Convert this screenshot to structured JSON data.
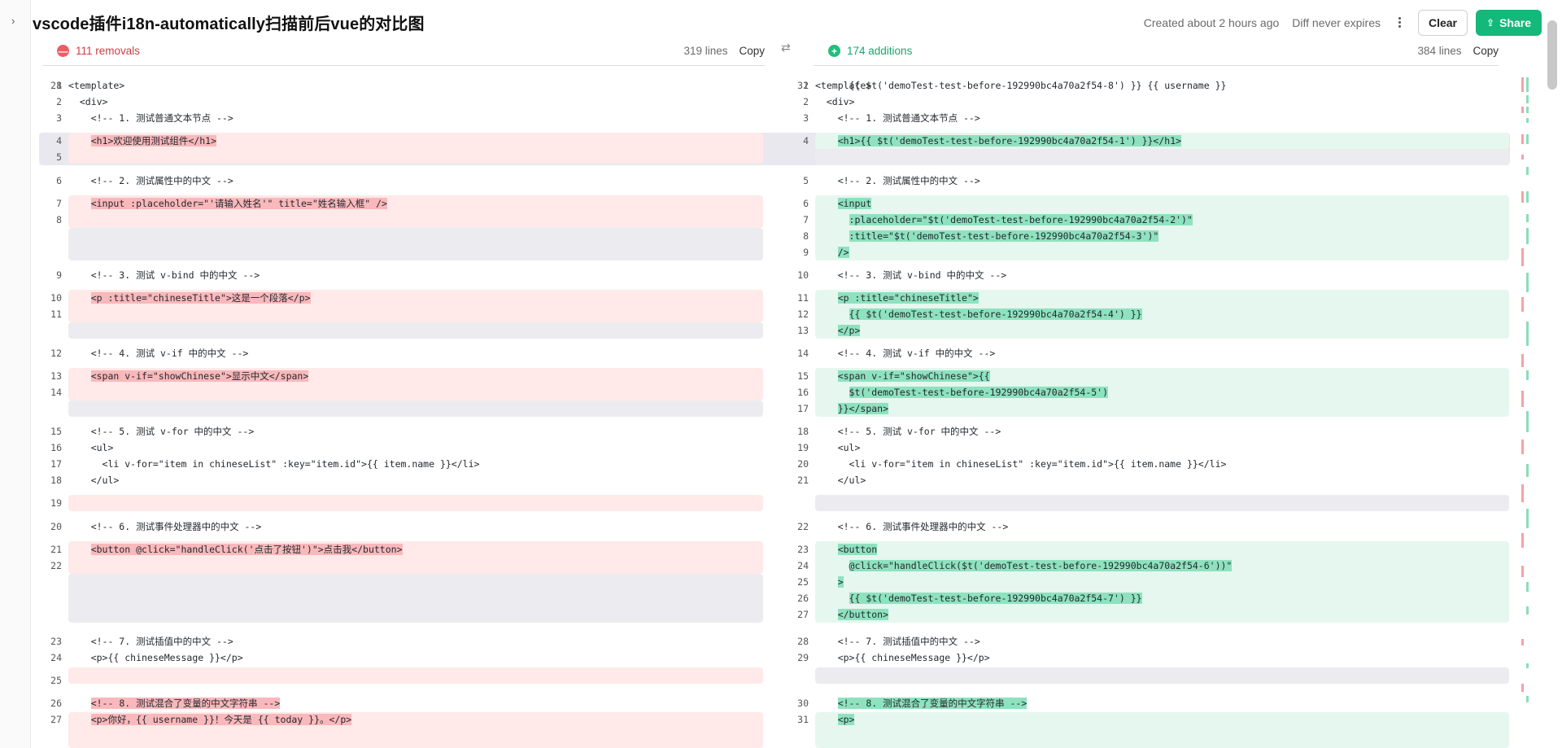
{
  "title": "vscode插件i18n-automatically扫描前后vue的对比图",
  "meta": {
    "created": "Created about 2 hours ago",
    "expires": "Diff never expires"
  },
  "buttons": {
    "clear": "Clear",
    "share": "Share"
  },
  "left": {
    "badge": "—",
    "stat": "111 removals",
    "lines": "319 lines",
    "copy": "Copy"
  },
  "right": {
    "badge": "+",
    "stat": "174 additions",
    "lines": "384 lines",
    "copy": "Copy"
  },
  "colors": {
    "removal": "#ffe9e9",
    "removal_highlight": "#f9b8bb",
    "addition": "#e6f7ef",
    "addition_highlight": "#8ee2bf",
    "share": "#14b87a"
  },
  "icons": {
    "sidebar": "chevron-right-icon",
    "menu": "more-vertical-icon",
    "share": "share-icon",
    "swap": "swap-icon"
  },
  "rows": [
    {
      "l": "1",
      "lt": "<template>",
      "r": "1",
      "rt": "<template>"
    },
    {
      "l": "2",
      "lt": "  <div>",
      "r": "2",
      "rt": "  <div>"
    },
    {
      "l": "3",
      "lt": "    <!-- 1. 测试普通文本节点 -->",
      "r": "3",
      "rt": "    <!-- 1. 测试普通文本节点 -->"
    },
    {
      "l": "4",
      "lt": "    <h1>欢迎使用测试组件</h1>",
      "r": "4",
      "rt": "    <h1>{{ $t('demoTest-test-before-192990bc4a70a2f54-1') }}</h1>"
    },
    {
      "l": "5",
      "lt": "",
      "r": "",
      "rt": ""
    },
    {
      "l": "6",
      "lt": "    <!-- 2. 测试属性中的中文 -->",
      "r": "5",
      "rt": "    <!-- 2. 测试属性中的中文 -->"
    },
    {
      "l": "7",
      "lt": "    <input :placeholder=\"'请输入姓名'\" title=\"姓名输入框\" />",
      "r": "6",
      "rt": "    <input"
    },
    {
      "l": "8",
      "lt": "",
      "r": "7",
      "rt": "      :placeholder=\"$t('demoTest-test-before-192990bc4a70a2f54-2')\""
    },
    {
      "l": "",
      "lt": "",
      "r": "8",
      "rt": "      :title=\"$t('demoTest-test-before-192990bc4a70a2f54-3')\""
    },
    {
      "l": "",
      "lt": "",
      "r": "9",
      "rt": "    />"
    },
    {
      "l": "9",
      "lt": "    <!-- 3. 测试 v-bind 中的中文 -->",
      "r": "10",
      "rt": "    <!-- 3. 测试 v-bind 中的中文 -->"
    },
    {
      "l": "10",
      "lt": "    <p :title=\"chineseTitle\">这是一个段落</p>",
      "r": "11",
      "rt": "    <p :title=\"chineseTitle\">"
    },
    {
      "l": "11",
      "lt": "",
      "r": "12",
      "rt": "      {{ $t('demoTest-test-before-192990bc4a70a2f54-4') }}"
    },
    {
      "l": "",
      "lt": "",
      "r": "13",
      "rt": "    </p>"
    },
    {
      "l": "12",
      "lt": "    <!-- 4. 测试 v-if 中的中文 -->",
      "r": "14",
      "rt": "    <!-- 4. 测试 v-if 中的中文 -->"
    },
    {
      "l": "13",
      "lt": "    <span v-if=\"showChinese\">显示中文</span>",
      "r": "15",
      "rt": "    <span v-if=\"showChinese\">{{"
    },
    {
      "l": "14",
      "lt": "",
      "r": "16",
      "rt": "      $t('demoTest-test-before-192990bc4a70a2f54-5')"
    },
    {
      "l": "",
      "lt": "",
      "r": "17",
      "rt": "    }}</span>"
    },
    {
      "l": "15",
      "lt": "    <!-- 5. 测试 v-for 中的中文 -->",
      "r": "18",
      "rt": "    <!-- 5. 测试 v-for 中的中文 -->"
    },
    {
      "l": "16",
      "lt": "    <ul>",
      "r": "19",
      "rt": "    <ul>"
    },
    {
      "l": "17",
      "lt": "      <li v-for=\"item in chineseList\" :key=\"item.id\">{{ item.name }}</li>",
      "r": "20",
      "rt": "      <li v-for=\"item in chineseList\" :key=\"item.id\">{{ item.name }}</li>"
    },
    {
      "l": "18",
      "lt": "    </ul>",
      "r": "21",
      "rt": "    </ul>"
    },
    {
      "l": "19",
      "lt": "",
      "r": "",
      "rt": ""
    },
    {
      "l": "20",
      "lt": "    <!-- 6. 测试事件处理器中的中文 -->",
      "r": "22",
      "rt": "    <!-- 6. 测试事件处理器中的中文 -->"
    },
    {
      "l": "21",
      "lt": "    <button @click=\"handleClick('点击了按钮')\">点击我</button>",
      "r": "23",
      "rt": "    <button"
    },
    {
      "l": "22",
      "lt": "",
      "r": "24",
      "rt": "      @click=\"handleClick($t('demoTest-test-before-192990bc4a70a2f54-6'))\""
    },
    {
      "l": "",
      "lt": "",
      "r": "25",
      "rt": "    >"
    },
    {
      "l": "",
      "lt": "",
      "r": "26",
      "rt": "      {{ $t('demoTest-test-before-192990bc4a70a2f54-7') }}"
    },
    {
      "l": "",
      "lt": "",
      "r": "27",
      "rt": "    </button>"
    },
    {
      "l": "23",
      "lt": "    <!-- 7. 测试插值中的中文 -->",
      "r": "28",
      "rt": "    <!-- 7. 测试插值中的中文 -->"
    },
    {
      "l": "24",
      "lt": "    <p>{{ chineseMessage }}</p>",
      "r": "29",
      "rt": "    <p>{{ chineseMessage }}</p>"
    },
    {
      "l": "25",
      "lt": "",
      "r": "",
      "rt": ""
    },
    {
      "l": "26",
      "lt": "    <!-- 8. 测试混合了变量的中文字符串 -->",
      "r": "30",
      "rt": "    <!-- 8. 测试混合了变量的中文字符串 -->"
    },
    {
      "l": "27",
      "lt": "    <p>你好，{{ username }}！今天是 {{ today }}。</p>",
      "r": "31",
      "rt": "    <p>"
    },
    {
      "l": "28",
      "lt": "",
      "r": "32",
      "rt": "      {{ $t('demoTest-test-before-192990bc4a70a2f54-8') }} {{ username }}"
    }
  ]
}
